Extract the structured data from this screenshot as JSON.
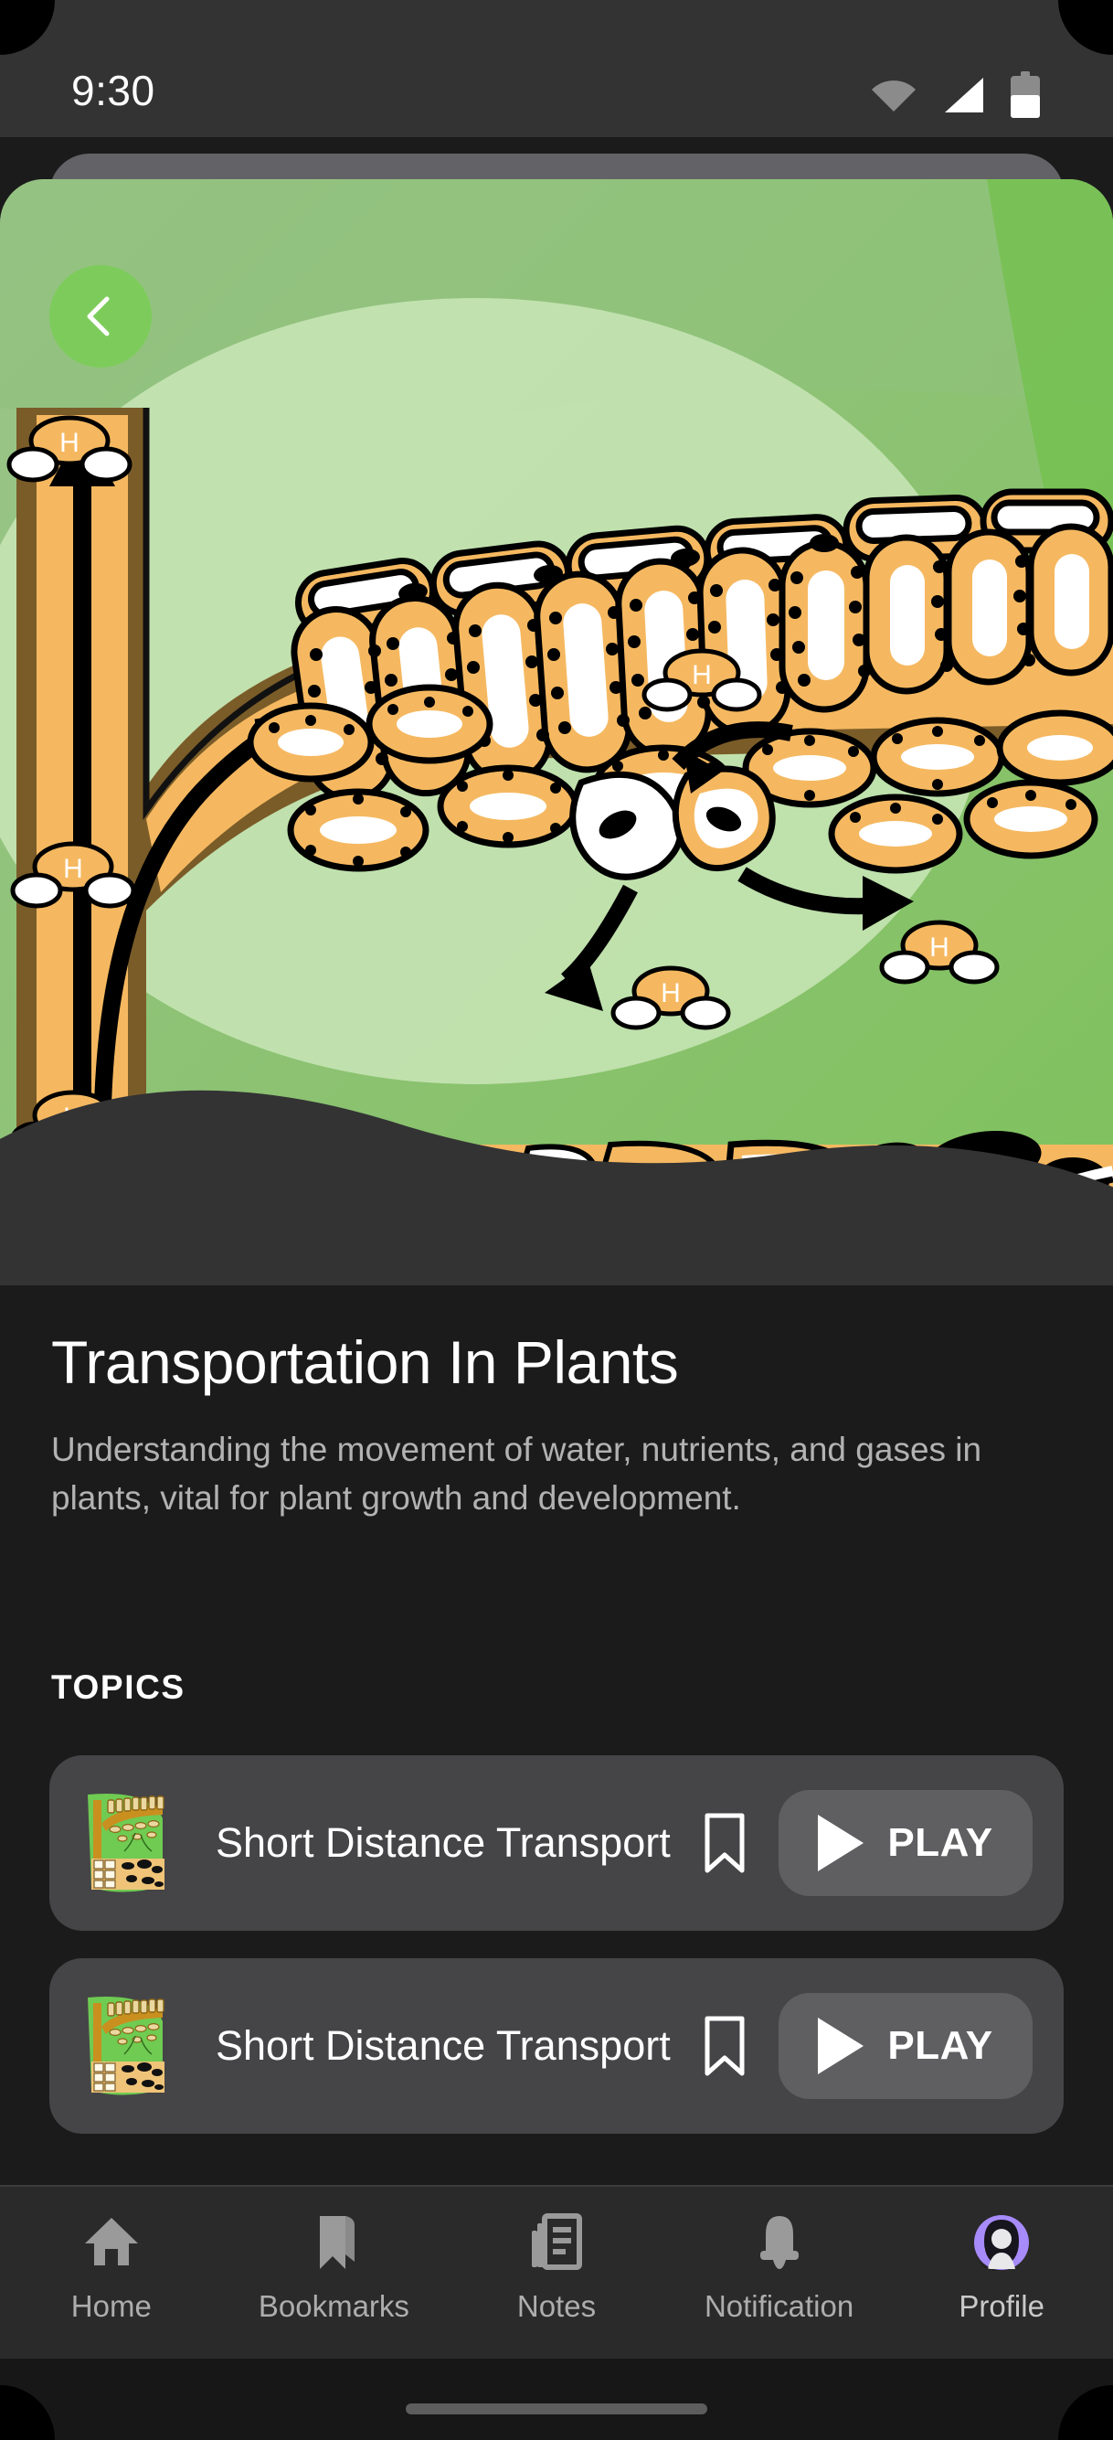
{
  "statusbar": {
    "time": "9:30",
    "icons": [
      "wifi-icon",
      "cellular-signal-icon",
      "battery-icon"
    ],
    "battery_level_pct": 50
  },
  "back_button": {
    "icon": "chevron-left-icon",
    "color": "#7DCC5B"
  },
  "hero": {
    "illustration_name": "plant-transport-diagram",
    "description": "Botanical cross-section illustration of water transport in a plant stem and leaf",
    "colors": {
      "background_green": "#8CBB7E",
      "background_green_light": "#C6E3B4",
      "cell_orange": "#F5B860",
      "stem_brown": "#7A5C28",
      "outline_black": "#000000",
      "page_dark": "#333333"
    },
    "molecule_label": "H"
  },
  "detail": {
    "title": "Transportation In Plants",
    "description": "Understanding the movement of water, nutrients, and gases in plants, vital for plant growth and development."
  },
  "topics_section": {
    "label": "TOPICS",
    "items": [
      {
        "thumbnail": "plant-transport-thumbnail",
        "name": "Short Distance Transport",
        "bookmark_icon": "bookmark-outline-icon",
        "play_icon": "play-triangle-icon",
        "play_label": "PLAY"
      },
      {
        "thumbnail": "plant-transport-thumbnail",
        "name": "Short Distance Transport",
        "bookmark_icon": "bookmark-outline-icon",
        "play_icon": "play-triangle-icon",
        "play_label": "PLAY"
      }
    ]
  },
  "bottom_nav": {
    "active": "Profile",
    "items": [
      {
        "label": "Home",
        "icon": "home-icon"
      },
      {
        "label": "Bookmarks",
        "icon": "bookmark-icon"
      },
      {
        "label": "Notes",
        "icon": "notes-icon"
      },
      {
        "label": "Notification",
        "icon": "bell-icon"
      },
      {
        "label": "Profile",
        "icon": "avatar-icon"
      }
    ],
    "accent": "#A78BFA"
  }
}
